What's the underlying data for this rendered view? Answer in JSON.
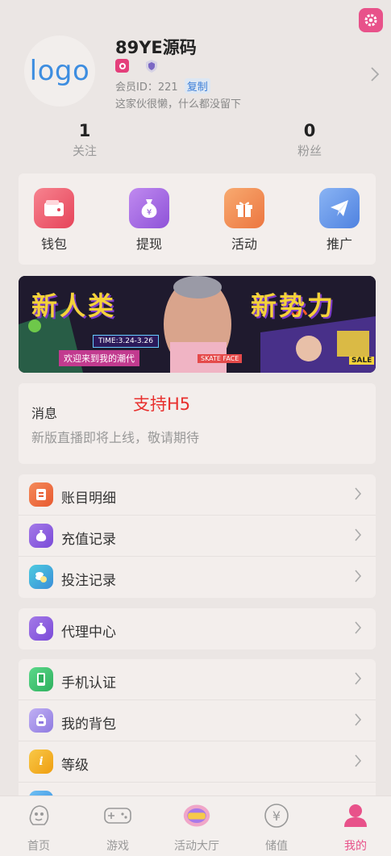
{
  "profile": {
    "avatar_text": "logo",
    "username": "89YE源码",
    "member_id_label": "会员ID：",
    "member_id": "221",
    "copy_label": "复制",
    "bio": "这家伙很懒，什么都没留下"
  },
  "stats": [
    {
      "value": "1",
      "label": "关注"
    },
    {
      "value": "0",
      "label": "粉丝"
    }
  ],
  "quick_actions": [
    {
      "label": "钱包",
      "icon": "wallet-icon",
      "color": "#ee5a6a"
    },
    {
      "label": "提现",
      "icon": "money-bag-icon",
      "color": "#a468e0"
    },
    {
      "label": "活动",
      "icon": "gift-icon",
      "color": "#f08a4e"
    },
    {
      "label": "推广",
      "icon": "paper-plane-icon",
      "color": "#5b8fe6"
    }
  ],
  "banner": {
    "left_text": "新人类",
    "right_text": "新势力",
    "date": "TIME:3.24-3.26",
    "welcome": "欢迎来到我的潮代",
    "brand": "SKATE FACE",
    "sale": "SALE"
  },
  "notice": {
    "title": "消息",
    "tag": "支持H5",
    "message": "新版直播即将上线，敬请期待"
  },
  "menu_group1": [
    {
      "label": "账目明细",
      "icon": "ledger-icon",
      "color": "#ef6a3a"
    },
    {
      "label": "充值记录",
      "icon": "money-bag-icon",
      "color": "#8a5ae0"
    },
    {
      "label": "投注记录",
      "icon": "coins-icon",
      "color": "#3ab0d8"
    }
  ],
  "menu_group2": [
    {
      "label": "代理中心",
      "icon": "money-bag-icon",
      "color": "#8a5ae0"
    }
  ],
  "menu_group3": [
    {
      "label": "手机认证",
      "icon": "phone-icon",
      "color": "#3ec26b"
    },
    {
      "label": "我的背包",
      "icon": "backpack-icon",
      "color": "#a090e8"
    },
    {
      "label": "等级",
      "icon": "info-icon",
      "color": "#f4b020",
      "glyph": "i"
    }
  ],
  "tabs": [
    {
      "label": "首页",
      "icon": "home-icon",
      "active": false
    },
    {
      "label": "游戏",
      "icon": "gamepad-icon",
      "active": false
    },
    {
      "label": "活动大厅",
      "icon": "activity-hall-icon",
      "active": false
    },
    {
      "label": "储值",
      "icon": "yuan-icon",
      "active": false
    },
    {
      "label": "我的",
      "icon": "user-icon",
      "active": true
    }
  ],
  "colors": {
    "accent": "#e8528a",
    "background": "#ebe6e4",
    "card": "#f3eeec",
    "notice_tag": "#e8302e",
    "link": "#3d7fd8"
  }
}
